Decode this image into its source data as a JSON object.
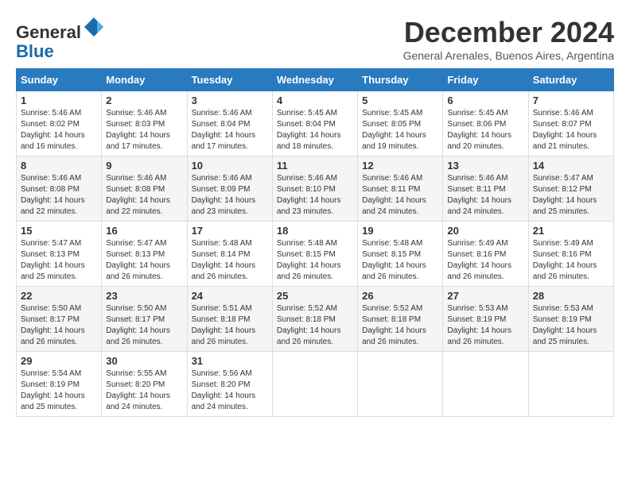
{
  "logo": {
    "general": "General",
    "blue": "Blue"
  },
  "header": {
    "month": "December 2024",
    "location": "General Arenales, Buenos Aires, Argentina"
  },
  "weekdays": [
    "Sunday",
    "Monday",
    "Tuesday",
    "Wednesday",
    "Thursday",
    "Friday",
    "Saturday"
  ],
  "weeks": [
    [
      {
        "day": "1",
        "sunrise": "5:46 AM",
        "sunset": "8:02 PM",
        "daylight": "14 hours and 16 minutes."
      },
      {
        "day": "2",
        "sunrise": "5:46 AM",
        "sunset": "8:03 PM",
        "daylight": "14 hours and 17 minutes."
      },
      {
        "day": "3",
        "sunrise": "5:46 AM",
        "sunset": "8:04 PM",
        "daylight": "14 hours and 17 minutes."
      },
      {
        "day": "4",
        "sunrise": "5:45 AM",
        "sunset": "8:04 PM",
        "daylight": "14 hours and 18 minutes."
      },
      {
        "day": "5",
        "sunrise": "5:45 AM",
        "sunset": "8:05 PM",
        "daylight": "14 hours and 19 minutes."
      },
      {
        "day": "6",
        "sunrise": "5:45 AM",
        "sunset": "8:06 PM",
        "daylight": "14 hours and 20 minutes."
      },
      {
        "day": "7",
        "sunrise": "5:46 AM",
        "sunset": "8:07 PM",
        "daylight": "14 hours and 21 minutes."
      }
    ],
    [
      {
        "day": "8",
        "sunrise": "5:46 AM",
        "sunset": "8:08 PM",
        "daylight": "14 hours and 22 minutes."
      },
      {
        "day": "9",
        "sunrise": "5:46 AM",
        "sunset": "8:08 PM",
        "daylight": "14 hours and 22 minutes."
      },
      {
        "day": "10",
        "sunrise": "5:46 AM",
        "sunset": "8:09 PM",
        "daylight": "14 hours and 23 minutes."
      },
      {
        "day": "11",
        "sunrise": "5:46 AM",
        "sunset": "8:10 PM",
        "daylight": "14 hours and 23 minutes."
      },
      {
        "day": "12",
        "sunrise": "5:46 AM",
        "sunset": "8:11 PM",
        "daylight": "14 hours and 24 minutes."
      },
      {
        "day": "13",
        "sunrise": "5:46 AM",
        "sunset": "8:11 PM",
        "daylight": "14 hours and 24 minutes."
      },
      {
        "day": "14",
        "sunrise": "5:47 AM",
        "sunset": "8:12 PM",
        "daylight": "14 hours and 25 minutes."
      }
    ],
    [
      {
        "day": "15",
        "sunrise": "5:47 AM",
        "sunset": "8:13 PM",
        "daylight": "14 hours and 25 minutes."
      },
      {
        "day": "16",
        "sunrise": "5:47 AM",
        "sunset": "8:13 PM",
        "daylight": "14 hours and 26 minutes."
      },
      {
        "day": "17",
        "sunrise": "5:48 AM",
        "sunset": "8:14 PM",
        "daylight": "14 hours and 26 minutes."
      },
      {
        "day": "18",
        "sunrise": "5:48 AM",
        "sunset": "8:15 PM",
        "daylight": "14 hours and 26 minutes."
      },
      {
        "day": "19",
        "sunrise": "5:48 AM",
        "sunset": "8:15 PM",
        "daylight": "14 hours and 26 minutes."
      },
      {
        "day": "20",
        "sunrise": "5:49 AM",
        "sunset": "8:16 PM",
        "daylight": "14 hours and 26 minutes."
      },
      {
        "day": "21",
        "sunrise": "5:49 AM",
        "sunset": "8:16 PM",
        "daylight": "14 hours and 26 minutes."
      }
    ],
    [
      {
        "day": "22",
        "sunrise": "5:50 AM",
        "sunset": "8:17 PM",
        "daylight": "14 hours and 26 minutes."
      },
      {
        "day": "23",
        "sunrise": "5:50 AM",
        "sunset": "8:17 PM",
        "daylight": "14 hours and 26 minutes."
      },
      {
        "day": "24",
        "sunrise": "5:51 AM",
        "sunset": "8:18 PM",
        "daylight": "14 hours and 26 minutes."
      },
      {
        "day": "25",
        "sunrise": "5:52 AM",
        "sunset": "8:18 PM",
        "daylight": "14 hours and 26 minutes."
      },
      {
        "day": "26",
        "sunrise": "5:52 AM",
        "sunset": "8:18 PM",
        "daylight": "14 hours and 26 minutes."
      },
      {
        "day": "27",
        "sunrise": "5:53 AM",
        "sunset": "8:19 PM",
        "daylight": "14 hours and 26 minutes."
      },
      {
        "day": "28",
        "sunrise": "5:53 AM",
        "sunset": "8:19 PM",
        "daylight": "14 hours and 25 minutes."
      }
    ],
    [
      {
        "day": "29",
        "sunrise": "5:54 AM",
        "sunset": "8:19 PM",
        "daylight": "14 hours and 25 minutes."
      },
      {
        "day": "30",
        "sunrise": "5:55 AM",
        "sunset": "8:20 PM",
        "daylight": "14 hours and 24 minutes."
      },
      {
        "day": "31",
        "sunrise": "5:56 AM",
        "sunset": "8:20 PM",
        "daylight": "14 hours and 24 minutes."
      },
      null,
      null,
      null,
      null
    ]
  ]
}
